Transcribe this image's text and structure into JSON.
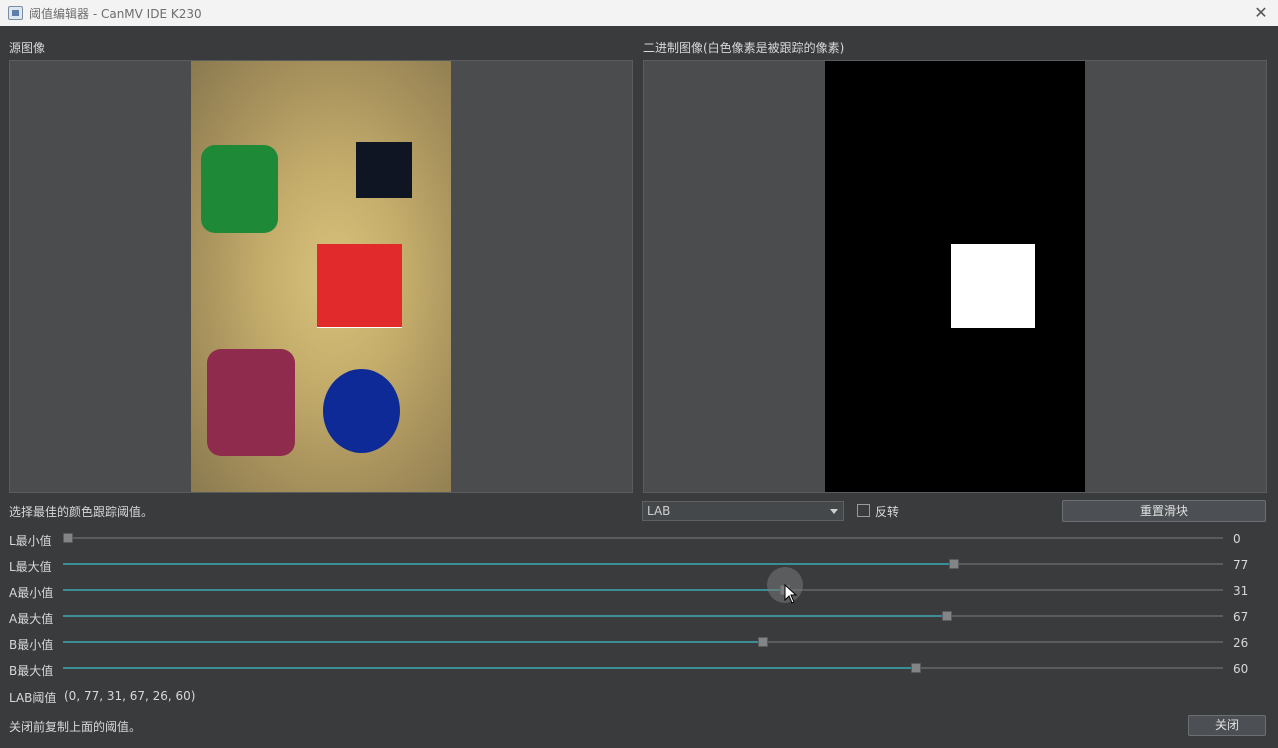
{
  "window": {
    "title": "阈值编辑器 - CanMV IDE K230",
    "close_glyph": "✕"
  },
  "source_panel": {
    "label": "源图像"
  },
  "binary_panel": {
    "label": "二进制图像(白色像素是被跟踪的像素)"
  },
  "instruction": "选择最佳的颜色跟踪阈值。",
  "controls": {
    "color_space": "LAB",
    "invert_label": "反转",
    "invert_checked": false,
    "reset_label": "重置滑块"
  },
  "sliders": [
    {
      "label": "L最小值",
      "value": "0",
      "min": 0,
      "max": 100
    },
    {
      "label": "L最大值",
      "value": "77",
      "min": 0,
      "max": 100
    },
    {
      "label": "A最小值",
      "value": "31",
      "min": -128,
      "max": 127
    },
    {
      "label": "A最大值",
      "value": "67",
      "min": -128,
      "max": 127
    },
    {
      "label": "B最小值",
      "value": "26",
      "min": -128,
      "max": 127
    },
    {
      "label": "B最大值",
      "value": "60",
      "min": -128,
      "max": 127
    }
  ],
  "threshold": {
    "label": "LAB阈值",
    "value": "(0, 77, 31, 67, 26, 60)"
  },
  "footer": {
    "note": "关闭前复制上面的阈值。",
    "close_label": "关闭"
  },
  "colors": {
    "accent": "#3d8d96",
    "background": "#393b3d"
  }
}
